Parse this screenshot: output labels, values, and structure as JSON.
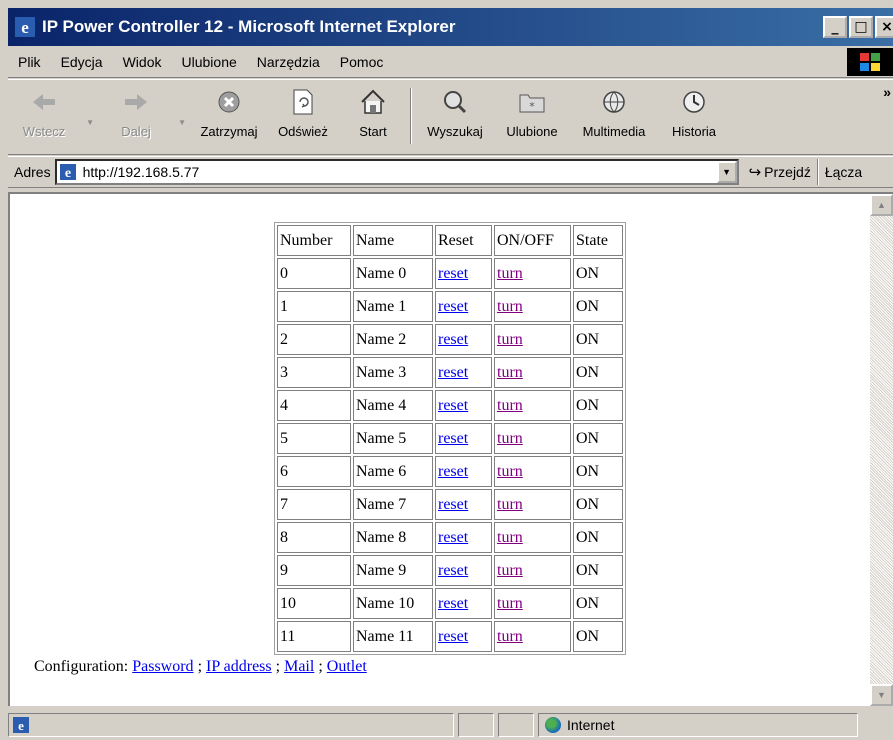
{
  "window": {
    "title": "IP Power Controller 12 - Microsoft Internet Explorer",
    "minimize_glyph": "_",
    "maximize_glyph": "□",
    "close_glyph": "×"
  },
  "menu": [
    {
      "label": "Plik"
    },
    {
      "label": "Edycja"
    },
    {
      "label": "Widok"
    },
    {
      "label": "Ulubione"
    },
    {
      "label": "Narzędzia"
    },
    {
      "label": "Pomoc"
    }
  ],
  "toolbar": {
    "back": "Wstecz",
    "forward": "Dalej",
    "stop": "Zatrzymaj",
    "refresh": "Odśwież",
    "home": "Start",
    "search": "Wyszukaj",
    "favorites": "Ulubione",
    "media": "Multimedia",
    "history": "Historia",
    "more": "»"
  },
  "address_bar": {
    "label": "Adres",
    "url": "http://192.168.5.77",
    "go_label": "Przejdź",
    "links_label": "Łącza"
  },
  "table": {
    "headers": [
      "Number",
      "Name",
      "Reset",
      "ON/OFF",
      "State"
    ],
    "rows": [
      {
        "number": "0",
        "name": "Name 0",
        "reset": "reset",
        "onoff": "turn",
        "state": "ON"
      },
      {
        "number": "1",
        "name": "Name 1",
        "reset": "reset",
        "onoff": "turn",
        "state": "ON"
      },
      {
        "number": "2",
        "name": "Name 2",
        "reset": "reset",
        "onoff": "turn",
        "state": "ON"
      },
      {
        "number": "3",
        "name": "Name 3",
        "reset": "reset",
        "onoff": "turn",
        "state": "ON"
      },
      {
        "number": "4",
        "name": "Name 4",
        "reset": "reset",
        "onoff": "turn",
        "state": "ON"
      },
      {
        "number": "5",
        "name": "Name 5",
        "reset": "reset",
        "onoff": "turn",
        "state": "ON"
      },
      {
        "number": "6",
        "name": "Name 6",
        "reset": "reset",
        "onoff": "turn",
        "state": "ON"
      },
      {
        "number": "7",
        "name": "Name 7",
        "reset": "reset",
        "onoff": "turn",
        "state": "ON"
      },
      {
        "number": "8",
        "name": "Name 8",
        "reset": "reset",
        "onoff": "turn",
        "state": "ON"
      },
      {
        "number": "9",
        "name": "Name 9",
        "reset": "reset",
        "onoff": "turn",
        "state": "ON"
      },
      {
        "number": "10",
        "name": "Name 10",
        "reset": "reset",
        "onoff": "turn",
        "state": "ON"
      },
      {
        "number": "11",
        "name": "Name 11",
        "reset": "reset",
        "onoff": "turn",
        "state": "ON"
      }
    ]
  },
  "config": {
    "label": "Configuration:",
    "sep": ";",
    "links": [
      "Password",
      "IP address",
      "Mail",
      "Outlet"
    ]
  },
  "status": {
    "zone": "Internet"
  },
  "colors": {
    "link": "#0000ee",
    "visited_link": "#800080",
    "titlebar": "#0a246a",
    "chrome": "#d4d0c8"
  }
}
